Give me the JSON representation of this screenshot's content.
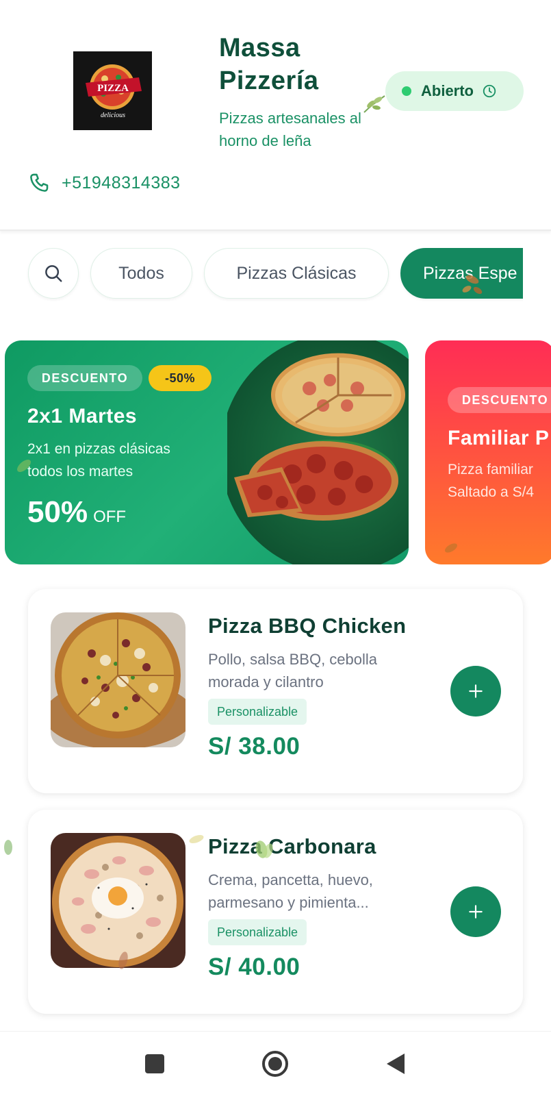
{
  "restaurant": {
    "name": "Massa Pizzería",
    "tagline": "Pizzas artesanales al horno de leña",
    "status": "Abierto",
    "phone": "+51948314383",
    "logo_text": "PIZZA",
    "logo_subtext": "delicious"
  },
  "categories": {
    "search_icon": "search-icon",
    "items": [
      {
        "label": "Todos",
        "active": false
      },
      {
        "label": "Pizzas Clásicas",
        "active": false
      },
      {
        "label": "Pizzas Espe",
        "active": true
      }
    ]
  },
  "promos": [
    {
      "tag": "DESCUENTO",
      "discount": "-50%",
      "title": "2x1 Martes",
      "description": "2x1 en pizzas clásicas todos los martes",
      "off_value": "50%",
      "off_label": "OFF"
    },
    {
      "tag": "DESCUENTO",
      "title": "Familiar P",
      "description_line1": "Pizza familiar",
      "description_line2": "Saltado a S/4"
    }
  ],
  "products": [
    {
      "name": "Pizza BBQ Chicken",
      "description": "Pollo, salsa BBQ, cebolla morada y cilantro",
      "tag": "Personalizable",
      "price": "S/ 38.00"
    },
    {
      "name": "Pizza Carbonara",
      "description": "Crema, pancetta, huevo, parmesano y pimienta...",
      "tag": "Personalizable",
      "price": "S/ 40.00"
    }
  ],
  "colors": {
    "primary": "#14885f",
    "title": "#0f4f3a",
    "status_bg": "#dff7e6",
    "promo_green": "#139a68",
    "promo_red": "#ff2d55",
    "discount_yellow": "#f5c518"
  },
  "system_nav": {
    "icons": [
      "recent-apps-icon",
      "home-icon",
      "back-icon"
    ]
  }
}
